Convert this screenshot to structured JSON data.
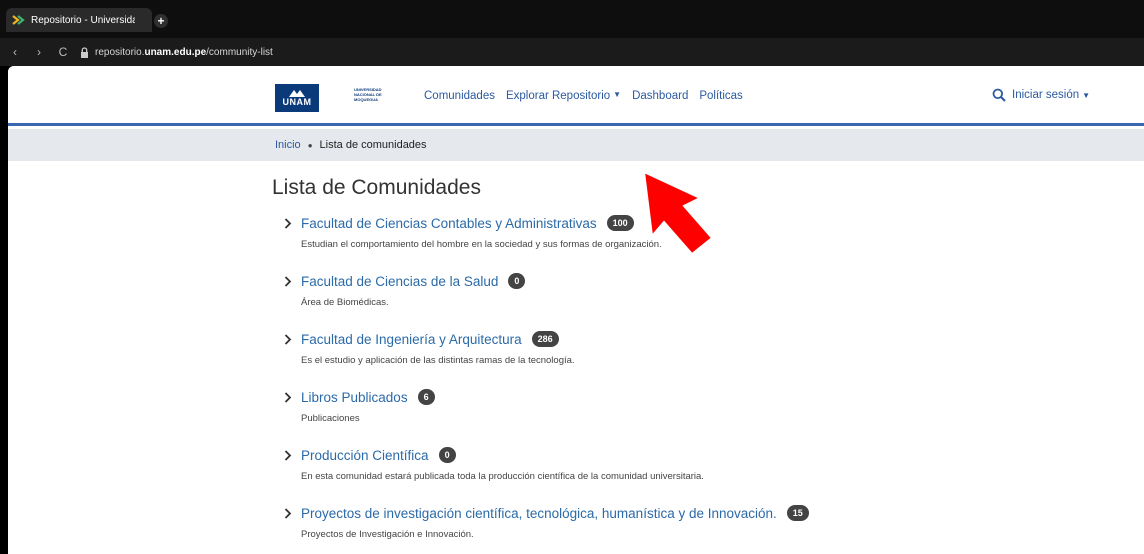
{
  "browser": {
    "tab_title": "Repositorio - Universidad",
    "new_tab_symbol": "+",
    "url_prefix": "repositorio.",
    "url_domain": "unam.edu.pe",
    "url_path": "/community-list",
    "back_symbol": "‹",
    "forward_symbol": "›",
    "reload_symbol": "C"
  },
  "header": {
    "logo_mark": "UNAM",
    "logo_caption": "UNIVERSIDAD NACIONAL DE MOQUEGUA",
    "nav": {
      "comunidades": "Comunidades",
      "explorar": "Explorar Repositorio",
      "dashboard": "Dashboard",
      "politicas": "Políticas"
    },
    "login": "Iniciar sesión"
  },
  "breadcrumb": {
    "home": "Inicio",
    "current": "Lista de comunidades"
  },
  "page_title": "Lista de Comunidades",
  "communities": [
    {
      "name": "Facultad de Ciencias Contables y Administrativas",
      "count": "100",
      "desc": "Estudian el comportamiento del hombre en la sociedad y sus formas de organización."
    },
    {
      "name": "Facultad de Ciencias de la Salud",
      "count": "0",
      "desc": "Área de Biomédicas."
    },
    {
      "name": "Facultad de Ingeniería y Arquitectura",
      "count": "286",
      "desc": "Es el estudio y aplicación de las distintas ramas de la tecnología."
    },
    {
      "name": "Libros Publicados",
      "count": "6",
      "desc": "Publicaciones"
    },
    {
      "name": "Producción Científica",
      "count": "0",
      "desc": "En esta comunidad estará publicada toda la producción científica de la comunidad universitaria."
    },
    {
      "name": "Proyectos de investigación científica, tecnológica, humanística y de Innovación.",
      "count": "15",
      "desc": "Proyectos de Investigación e Innovación."
    }
  ],
  "colors": {
    "link": "#2b6aa8",
    "header_border": "#3a68b0",
    "breadcrumb_bg": "#e5e9ed",
    "badge": "#444444",
    "annotation_arrow": "#ff0000"
  }
}
